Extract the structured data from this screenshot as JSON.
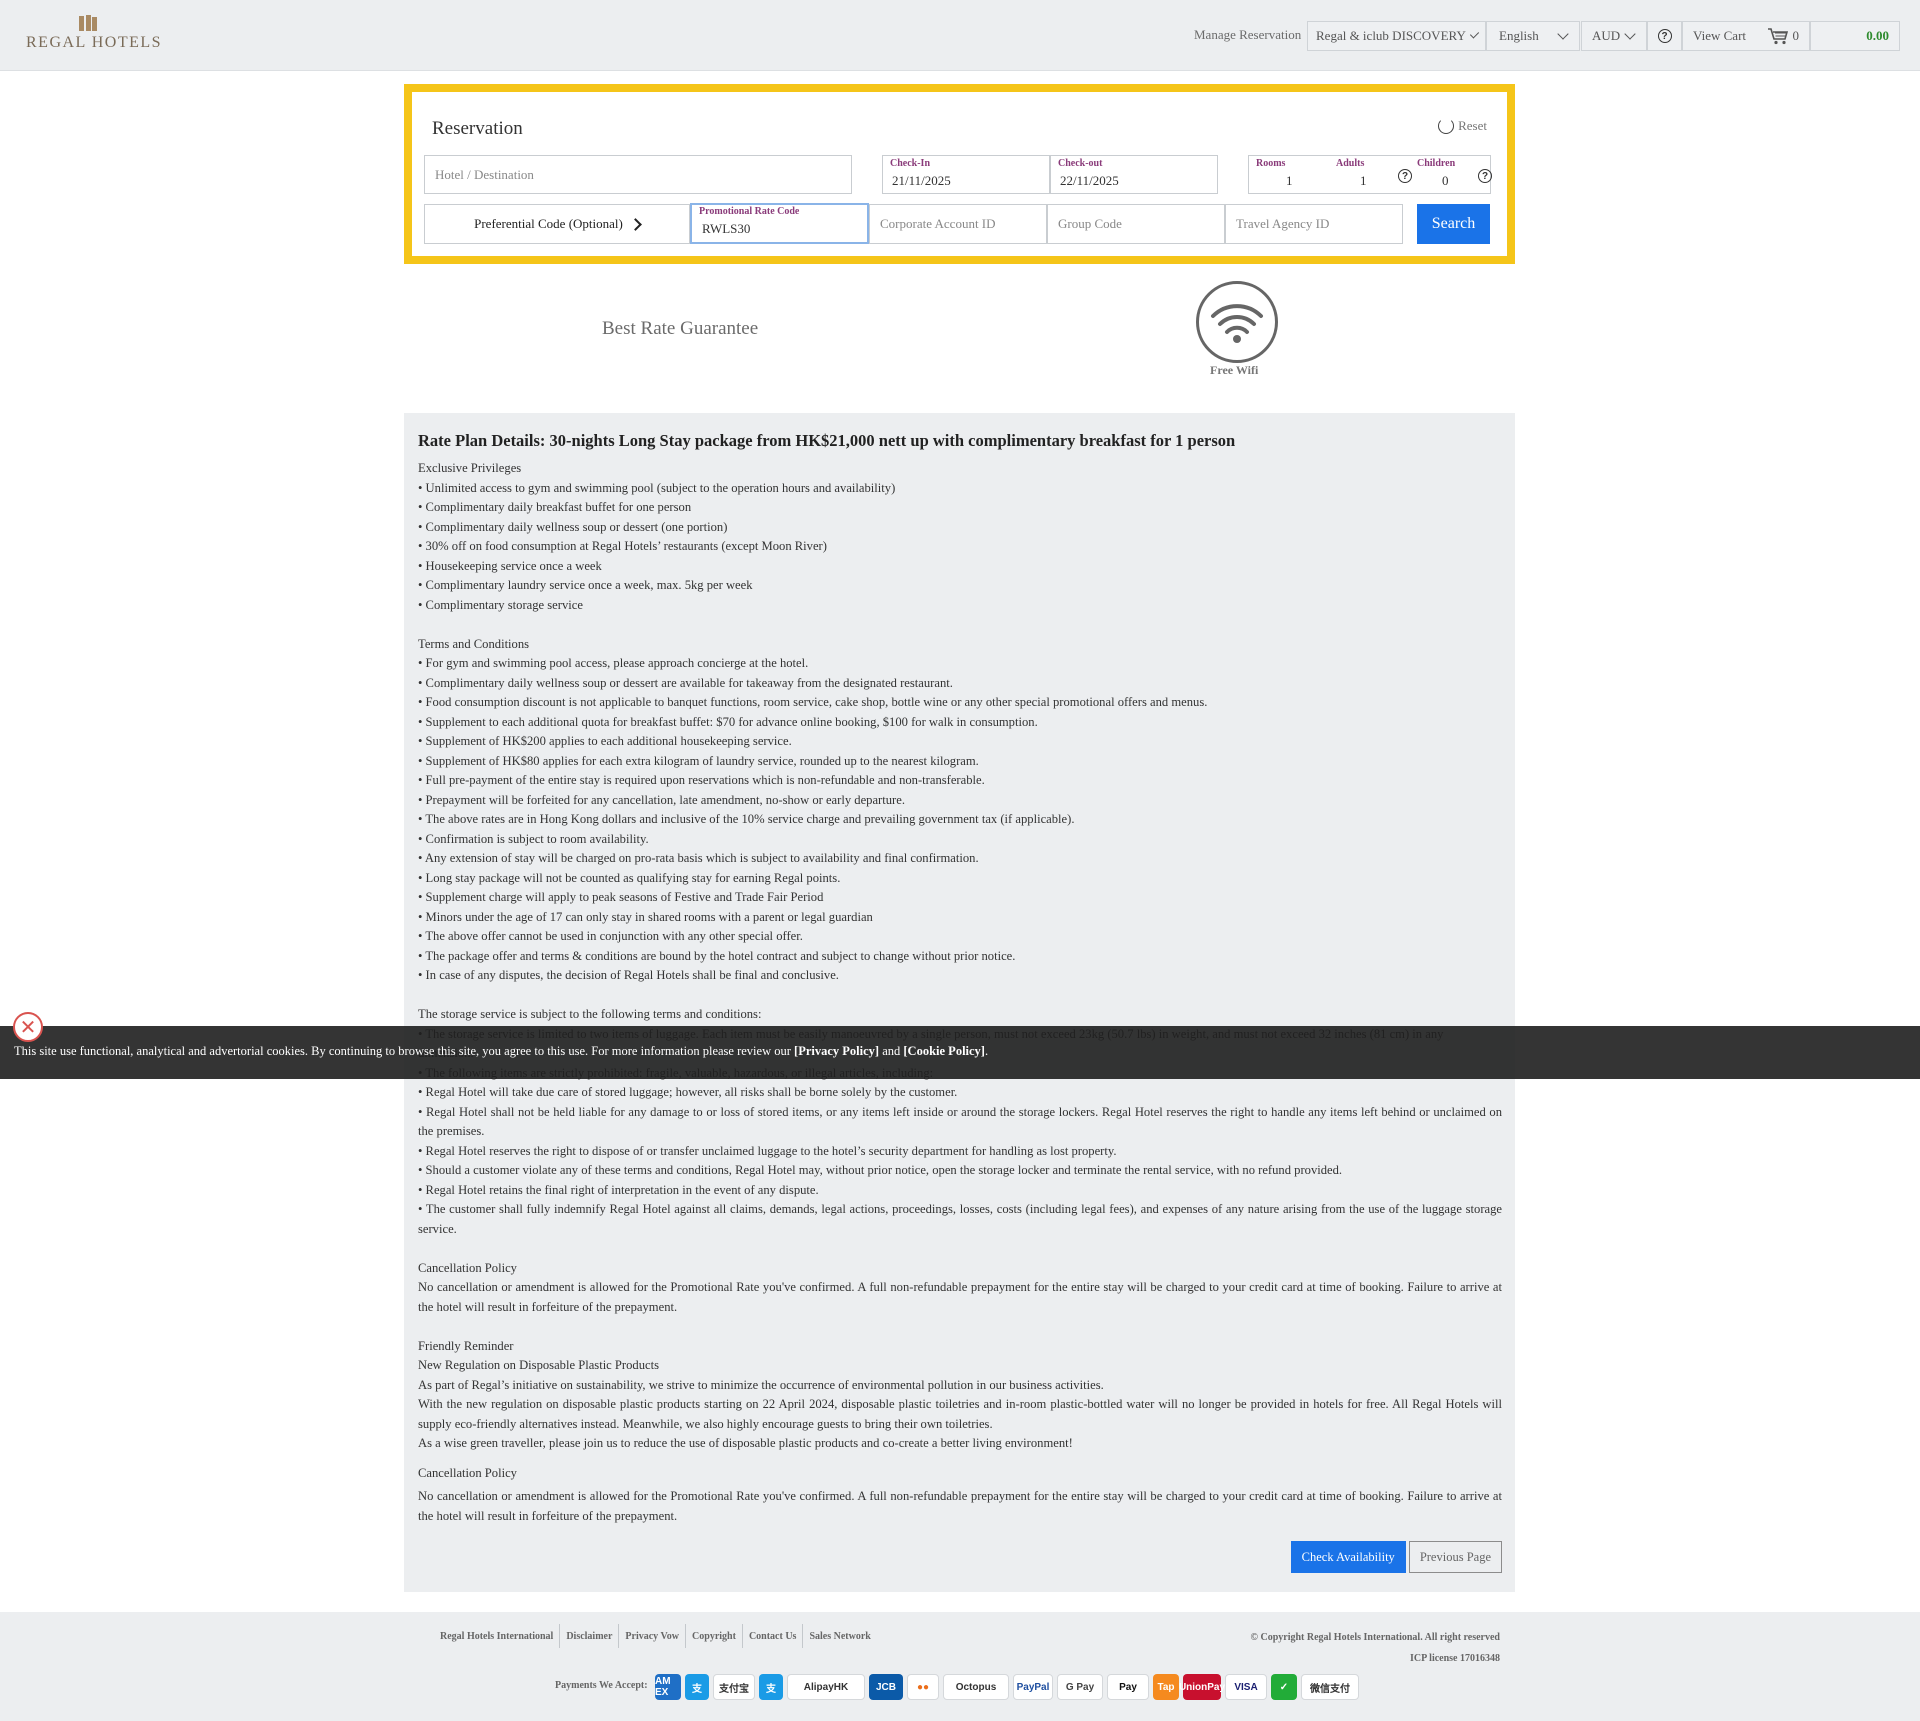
{
  "header": {
    "logo_text": "REGAL HOTELS",
    "manage_reservation": "Manage Reservation",
    "program": "Regal & iclub DISCOVERY",
    "language": "English",
    "currency": "AUD",
    "help_glyph": "?",
    "view_cart": "View Cart",
    "cart_count": "0",
    "cart_total": "0.00"
  },
  "reservation": {
    "title": "Reservation",
    "reset": "Reset",
    "hotel_placeholder": "Hotel / Destination",
    "checkin_label": "Check-In",
    "checkin_value": "21/11/2025",
    "checkout_label": "Check-out",
    "checkout_value": "22/11/2025",
    "rooms_label": "Rooms",
    "rooms_value": "1",
    "adults_label": "Adults",
    "adults_value": "1",
    "children_label": "Children",
    "children_value": "0",
    "preferential_code": "Preferential Code (Optional)",
    "promo_label": "Promotional Rate Code",
    "promo_value": "RWLS30",
    "corporate_placeholder": "Corporate Account ID",
    "group_placeholder": "Group Code",
    "agency_placeholder": "Travel Agency ID",
    "search": "Search"
  },
  "features": {
    "best_rate": "Best Rate Guarantee",
    "wifi": "Free Wifi"
  },
  "rate_plan": {
    "title": "Rate Plan Details: 30-nights Long Stay package from HK$21,000 nett up with complimentary breakfast for 1 person",
    "privileges_heading": "Exclusive Privileges",
    "privileges": [
      "• Unlimited access to gym and swimming pool (subject to the operation hours and availability)",
      "• Complimentary daily breakfast buffet for one person",
      "• Complimentary daily wellness soup or dessert (one portion)",
      "• 30% off on food consumption at Regal Hotels’ restaurants (except Moon River)",
      "• Housekeeping service once a week",
      "• Complimentary laundry service once a week, max. 5kg per week",
      "• Complimentary storage service"
    ],
    "terms_heading": "Terms and Conditions",
    "terms": [
      "• For gym and swimming pool access, please approach concierge at the hotel.",
      "• Complimentary daily wellness soup or dessert are available for takeaway from the designated restaurant.",
      "• Food consumption discount is not applicable to banquet functions, room service, cake shop, bottle wine or any other special promotional offers and menus.",
      "• Supplement to each additional quota for breakfast buffet: $70 for advance online booking, $100 for walk in consumption.",
      "• Supplement of HK$200 applies to each additional housekeeping service.",
      "• Supplement of HK$80 applies for each extra kilogram of laundry service, rounded up to the nearest kilogram.",
      "• Full pre-payment of the entire stay is required upon reservations which is non-refundable and non-transferable.",
      "• Prepayment will be forfeited for any cancellation, late amendment, no-show or early departure.",
      "• The above rates are in Hong Kong dollars and inclusive of the 10% service charge and prevailing government tax (if applicable).",
      "• Confirmation is subject to room availability.",
      "• Any extension of stay will be charged on pro-rata basis which is subject to availability and final confirmation.",
      "• Long stay package will not be counted as qualifying stay for earning Regal points.",
      "• Supplement charge will apply to peak seasons of Festive and Trade Fair Period",
      "• Minors under the age of 17 can only stay in shared rooms with a parent or legal guardian",
      "• The above offer cannot be used in conjunction with any other special offer.",
      "• The package offer and terms & conditions are bound by the hotel contract and subject to change without prior notice.",
      "• In case of any disputes, the decision of Regal Hotels shall be final and conclusive."
    ],
    "storage_heading": "The storage service is subject to the following terms and conditions:",
    "storage": [
      "• The storage service is limited to two items of luggage. Each item must be easily manoeuvred by a single person, must not exceed 23kg (50.7 lbs) in weight, and must not exceed 32 inches (81 cm) in any",
      "dimension.",
      "• The following items are strictly prohibited: fragile, valuable, hazardous, or illegal articles, including:",
      "• Regal Hotel will take due care of stored luggage; however, all risks shall be borne solely by the customer.",
      "• Regal Hotel shall not be held liable for any damage to or loss of stored items, or any items left inside or around the storage lockers. Regal Hotel reserves the right to handle any items left behind or unclaimed on the premises.",
      "• Regal Hotel reserves the right to dispose of or transfer unclaimed luggage to the hotel’s security department for handling as lost property.",
      "• Should a customer violate any of these terms and conditions, Regal Hotel may, without prior notice, open the storage locker and terminate the rental service, with no refund provided.",
      "• Regal Hotel retains the final right of interpretation in the event of any dispute.",
      "• The customer shall fully indemnify Regal Hotel against all claims, demands, legal actions, proceedings, losses, costs (including legal fees), and expenses of any nature arising from the use of the luggage storage service."
    ],
    "cancel_heading": "Cancellation Policy",
    "cancel_text": "No cancellation or amendment is allowed for the Promotional Rate you've confirmed. A full non-refundable prepayment for the entire stay will be charged to your credit card at time of booking. Failure to arrive at the hotel will result in forfeiture of the prepayment.",
    "reminder_heading": "Friendly Reminder",
    "reminder_sub": "New Regulation on Disposable Plastic Products",
    "reminder_1": "As part of Regal’s initiative on sustainability, we strive to minimize the occurrence of environmental pollution in our business activities.",
    "reminder_2": "With the new regulation on disposable plastic products starting on 22 April 2024, disposable plastic toiletries and in-room plastic-bottled water will no longer be provided in hotels for free. All Regal Hotels will supply eco-friendly alternatives instead. Meanwhile, we also highly encourage guests to bring their own toiletries.",
    "reminder_3": "As a wise green traveller, please join us to reduce the use of disposable plastic products and co-create a better living environment!",
    "cancel_heading_2": "Cancellation Policy",
    "cancel_text_2": "No cancellation or amendment is allowed for the Promotional Rate you've confirmed. A full non-refundable prepayment for the entire stay will be charged to your credit card at time of booking. Failure to arrive at the hotel will result in forfeiture of the prepayment.",
    "check_availability": "Check Availability",
    "previous_page": "Previous Page"
  },
  "cookie": {
    "text": "This site use functional, analytical and advertorial cookies. By continuing to browse this site, you agree to this use. For more information please review our",
    "privacy": "[Privacy Policy]",
    "and": "and",
    "cookie_policy": "[Cookie Policy]",
    "period": ".",
    "close_glyph": "✕"
  },
  "footer": {
    "links": [
      "Regal Hotels International",
      "Disclaimer",
      "Privacy Vow",
      "Copyright",
      "Contact Us",
      "Sales Network"
    ],
    "copyright": "© Copyright Regal Hotels International. All right reserved",
    "icp": "ICP license 17016348",
    "payments_label": "Payments We Accept:",
    "payments": [
      {
        "name": "amex-logo",
        "text": "AM EX",
        "bg": "#1f6fc6",
        "fg": "#ffffff",
        "w": 26
      },
      {
        "name": "alipay-icon-logo",
        "text": "支",
        "bg": "#1a9be6",
        "fg": "#ffffff",
        "w": 24
      },
      {
        "name": "alipay-cn-logo",
        "text": "支付宝",
        "bg": "#ffffff",
        "fg": "#333333",
        "w": 42
      },
      {
        "name": "alipay-hk-icon-logo",
        "text": "支",
        "bg": "#1a9be6",
        "fg": "#ffffff",
        "w": 24
      },
      {
        "name": "alipay-hk-logo",
        "text": "AlipayHK",
        "bg": "#ffffff",
        "fg": "#333333",
        "w": 78
      },
      {
        "name": "jcb-logo",
        "text": "JCB",
        "bg": "#0b5aa8",
        "fg": "#ffffff",
        "w": 34
      },
      {
        "name": "mastercard-logo",
        "text": "●●",
        "bg": "#ffffff",
        "fg": "#eb6f1c",
        "w": 32
      },
      {
        "name": "octopus-logo",
        "text": "Octopus",
        "bg": "#ffffff",
        "fg": "#333333",
        "w": 66
      },
      {
        "name": "paypal-logo",
        "text": "PayPal",
        "bg": "#ffffff",
        "fg": "#1f4fa0",
        "w": 40
      },
      {
        "name": "google-pay-logo",
        "text": "G Pay",
        "bg": "#ffffff",
        "fg": "#444444",
        "w": 46
      },
      {
        "name": "apple-pay-logo",
        "text": "Pay",
        "bg": "#ffffff",
        "fg": "#111111",
        "w": 42
      },
      {
        "name": "tap-go-logo",
        "text": "Tap",
        "bg": "#f58a1f",
        "fg": "#ffffff",
        "w": 26
      },
      {
        "name": "unionpay-logo",
        "text": "UnionPay",
        "bg": "#c8102e",
        "fg": "#ffffff",
        "w": 38
      },
      {
        "name": "visa-logo",
        "text": "VISA",
        "bg": "#ffffff",
        "fg": "#1a1f71",
        "w": 42
      },
      {
        "name": "wechat-pay-icon-logo",
        "text": "✓",
        "bg": "#22ac38",
        "fg": "#ffffff",
        "w": 26
      },
      {
        "name": "wechat-pay-logo",
        "text": "微信支付",
        "bg": "#ffffff",
        "fg": "#333333",
        "w": 58
      }
    ]
  },
  "colors": {
    "accent": "#1a73e8",
    "highlight": "#f5c519",
    "label": "#8a3b7a",
    "cart_total": "#2e8b2e"
  }
}
